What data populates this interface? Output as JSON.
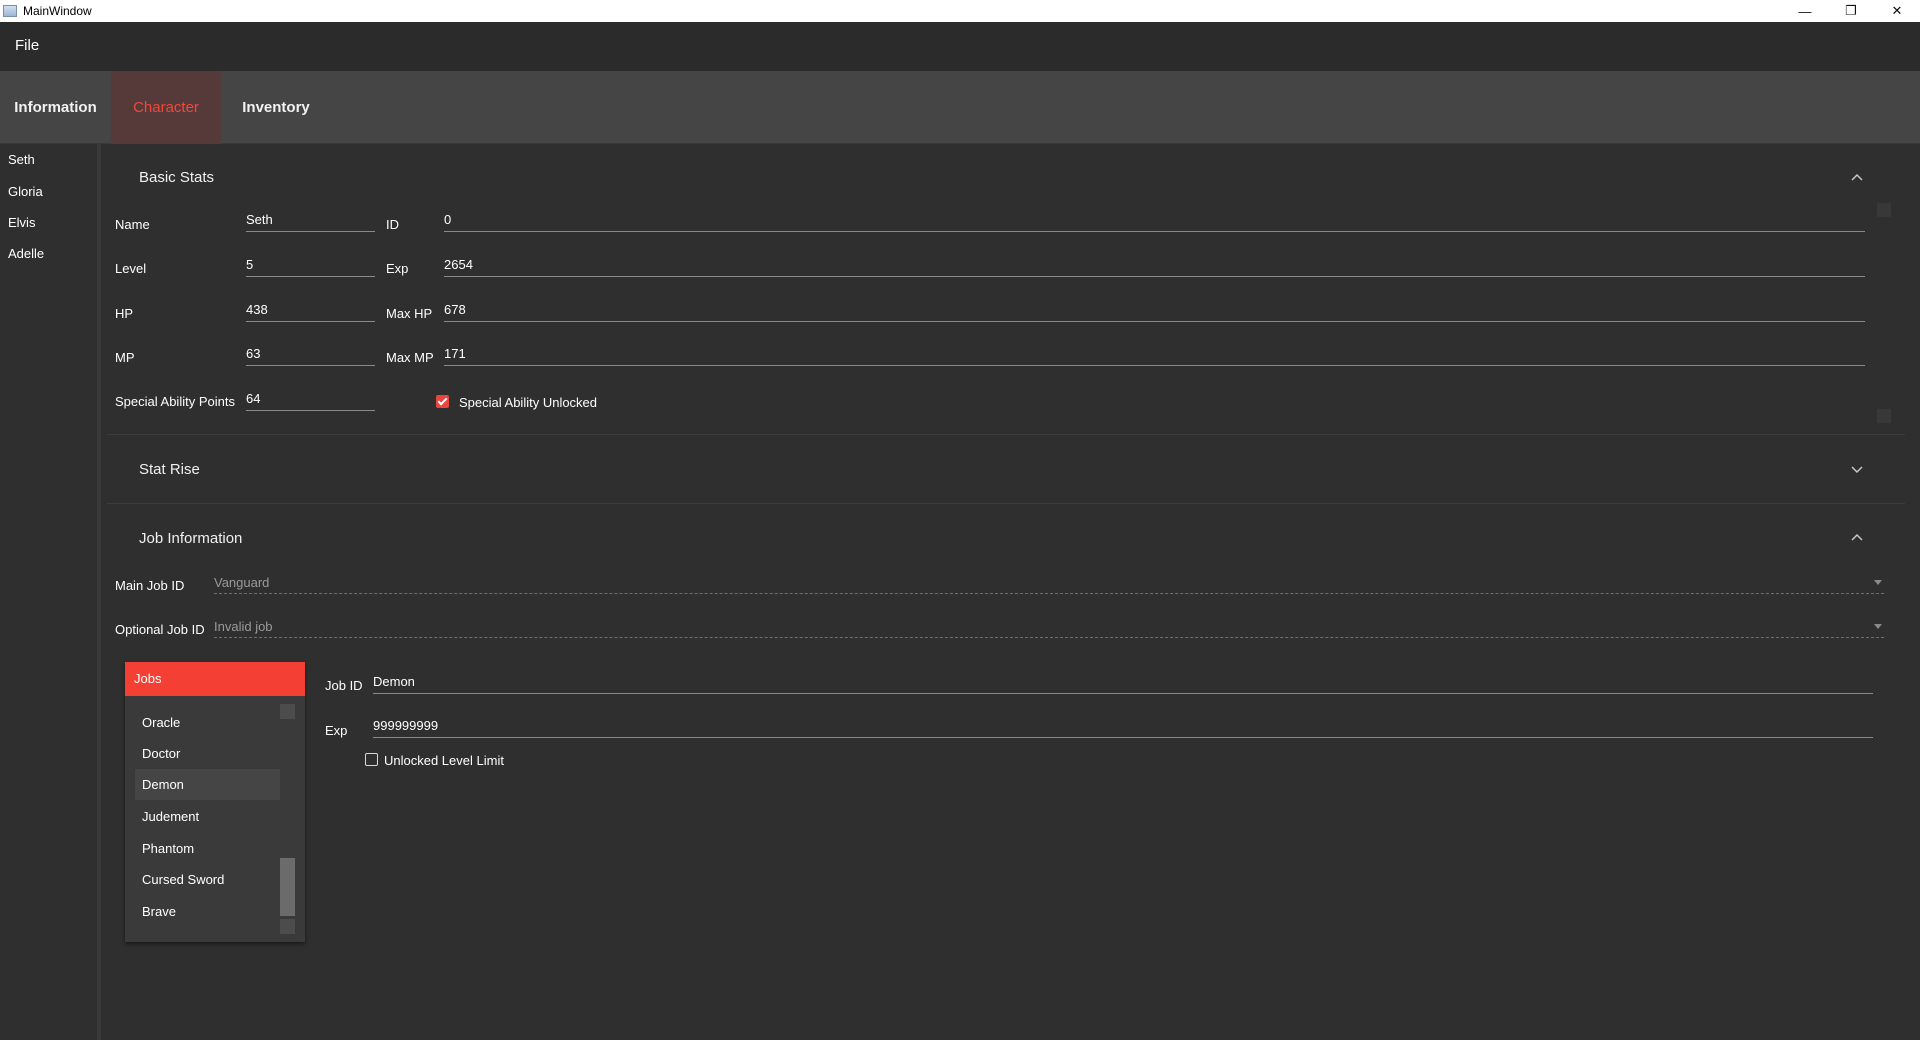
{
  "window": {
    "title": "MainWindow",
    "minimize": "—",
    "restore": "❐",
    "close": "✕"
  },
  "menu": {
    "file": "File"
  },
  "tabs": [
    {
      "label": "Information",
      "active": false
    },
    {
      "label": "Character",
      "active": true
    },
    {
      "label": "Inventory",
      "active": false
    }
  ],
  "sidebar": {
    "items": [
      "Seth",
      "Gloria",
      "Elvis",
      "Adelle"
    ]
  },
  "basic_stats": {
    "title": "Basic Stats",
    "name_label": "Name",
    "name_value": "Seth",
    "id_label": "ID",
    "id_value": "0",
    "level_label": "Level",
    "level_value": "5",
    "exp_label": "Exp",
    "exp_value": "2654",
    "hp_label": "HP",
    "hp_value": "438",
    "maxhp_label": "Max HP",
    "maxhp_value": "678",
    "mp_label": "MP",
    "mp_value": "63",
    "maxmp_label": "Max MP",
    "maxmp_value": "171",
    "sap_label": "Special Ability Points",
    "sap_value": "64",
    "unlocked_label": "Special Ability Unlocked",
    "unlocked_checked": true
  },
  "stat_rise": {
    "title": "Stat Rise"
  },
  "job_info": {
    "title": "Job Information",
    "main_job_label": "Main Job ID",
    "main_job_value": "Vanguard",
    "optional_job_label": "Optional Job ID",
    "optional_job_value": "Invalid job",
    "jobs_header": "Jobs",
    "jobs": [
      "Oracle",
      "Doctor",
      "Demon",
      "Judement",
      "Phantom",
      "Cursed Sword",
      "Brave"
    ],
    "selected_job": "Demon",
    "job_id_label": "Job ID",
    "job_id_value": "Demon",
    "job_exp_label": "Exp",
    "job_exp_value": "999999999",
    "unlocked_level_limit_label": "Unlocked Level Limit",
    "unlocked_level_limit_checked": false
  },
  "colors": {
    "accent": "#f43f34",
    "background": "#2f2f2f",
    "tab_bar": "#454545"
  }
}
